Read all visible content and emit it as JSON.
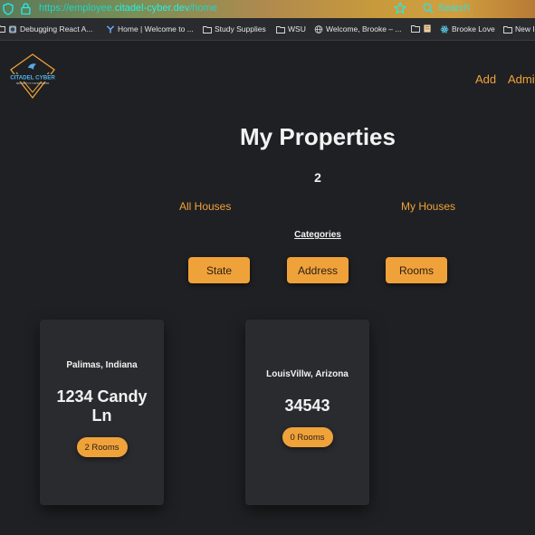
{
  "browser": {
    "url_scheme": "https://",
    "url_subdomain": "employee.",
    "url_host": "citadel-cyber.dev",
    "url_path": "/home",
    "search_label": "Search",
    "bookmarks": [
      {
        "label": "Debugging React A..."
      },
      {
        "label": "Home | Welcome to ..."
      },
      {
        "label": "Study Supplies"
      },
      {
        "label": "WSU"
      },
      {
        "label": "Welcome, Brooke – ..."
      },
      {
        "label": ""
      },
      {
        "label": "Brooke Love"
      },
      {
        "label": "New I"
      }
    ]
  },
  "header": {
    "logo_text": "CITADEL CYBER",
    "logo_tagline": "SECURITY IS OUR BUSINESS",
    "nav": [
      "Add",
      "Admin"
    ]
  },
  "main": {
    "title": "My Properties",
    "count": "2",
    "tabs": [
      "All Houses",
      "My Houses"
    ],
    "categories_label": "Categories",
    "category_buttons": [
      "State",
      "Address",
      "Rooms"
    ]
  },
  "properties": [
    {
      "location": "Palimas, Indiana",
      "address": "1234 Candy Ln",
      "rooms": "2 Rooms"
    },
    {
      "location": "LouisVillw, Arizona",
      "address": "34543",
      "rooms": "0 Rooms"
    }
  ],
  "colors": {
    "accent": "#f0a23a",
    "background": "#1f2023",
    "card": "#2a2b2f",
    "url_teal": "#1fd5c8"
  }
}
